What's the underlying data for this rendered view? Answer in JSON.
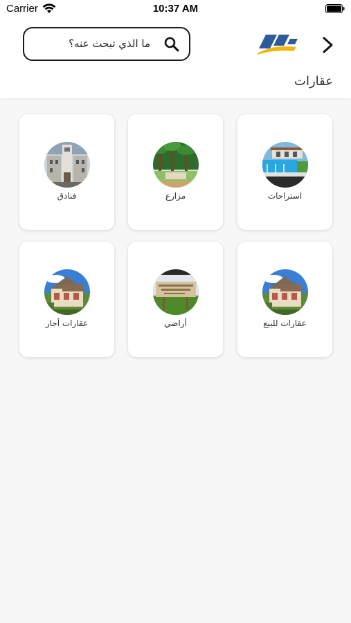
{
  "status_bar": {
    "carrier": "Carrier",
    "time": "10:37 AM"
  },
  "header": {
    "search_placeholder": "ما الذي تبحث عنه؟",
    "page_title": "عقارات"
  },
  "categories": [
    {
      "label": "استراحات",
      "icon": "rest-house-photo"
    },
    {
      "label": "مزارع",
      "icon": "farm-photo"
    },
    {
      "label": "فنادق",
      "icon": "hotel-photo"
    },
    {
      "label": "عقارات للبيع",
      "icon": "house-for-sale-photo"
    },
    {
      "label": "أراضي",
      "icon": "land-photo"
    },
    {
      "label": "عقارات أجار",
      "icon": "house-for-rent-photo"
    }
  ],
  "colors": {
    "background": "#f7f7f7",
    "card": "#ffffff",
    "logo_blue": "#2c5a9a",
    "logo_yellow": "#f2b70f"
  }
}
